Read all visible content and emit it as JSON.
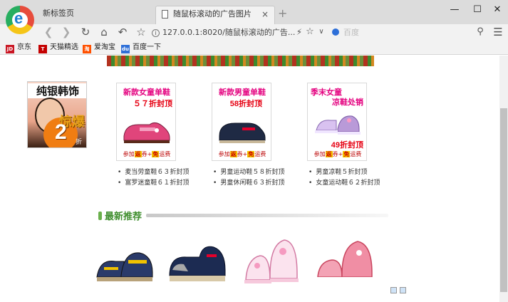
{
  "browser": {
    "tabs": [
      {
        "label": "新标签页",
        "active": false
      },
      {
        "label": "随鼠标滚动的广告图片",
        "active": true
      }
    ],
    "close_glyph": "×",
    "new_tab_glyph": "+",
    "address": "127.0.0.1:8020/随鼠标滚动的广告...",
    "search_placeholder": "百度",
    "bookmarks": [
      {
        "label": "京东",
        "icon": "JD",
        "color": "#c91623"
      },
      {
        "label": "天猫精选",
        "icon": "T",
        "color": "#c40000"
      },
      {
        "label": "爱淘宝",
        "icon": "淘",
        "color": "#ff5000"
      },
      {
        "label": "百度一下",
        "icon": "du",
        "color": "#2e6fd8"
      }
    ]
  },
  "page": {
    "side_ad": {
      "line1": "纯银韩饰",
      "line2": "惊爆",
      "number": "2",
      "suffix": "折"
    },
    "promos": [
      {
        "title": "新款女童单鞋",
        "sub": "５７折封顶",
        "foot_pre": "参加",
        "foot_a": "返",
        "foot_mid": "券+",
        "foot_b": "免",
        "foot_post": "运费",
        "shoe_color": "#e0457b"
      },
      {
        "title": "新款男童单鞋",
        "sub": "58折封顶",
        "foot_pre": "参加",
        "foot_a": "返",
        "foot_mid": "券+",
        "foot_b": "免",
        "foot_post": "运费",
        "shoe_color": "#1f2a44"
      },
      {
        "title": "季末女童",
        "title2": "凉鞋处销",
        "sub": "49折封顶",
        "foot_pre": "参加",
        "foot_a": "返",
        "foot_mid": "券+",
        "foot_b": "免",
        "foot_post": "运费",
        "shoe_color": "#b99ad8"
      }
    ],
    "lists": [
      [
        "麦当劳童鞋６３折封顶",
        "富罗迷童鞋６１折封顶"
      ],
      [
        "男童运动鞋５８折封顶",
        "男童休闲鞋６３折封顶"
      ],
      [
        "男童凉鞋５折封顶",
        "女童运动鞋６２折封顶"
      ]
    ],
    "section_title": "最新推荐"
  }
}
